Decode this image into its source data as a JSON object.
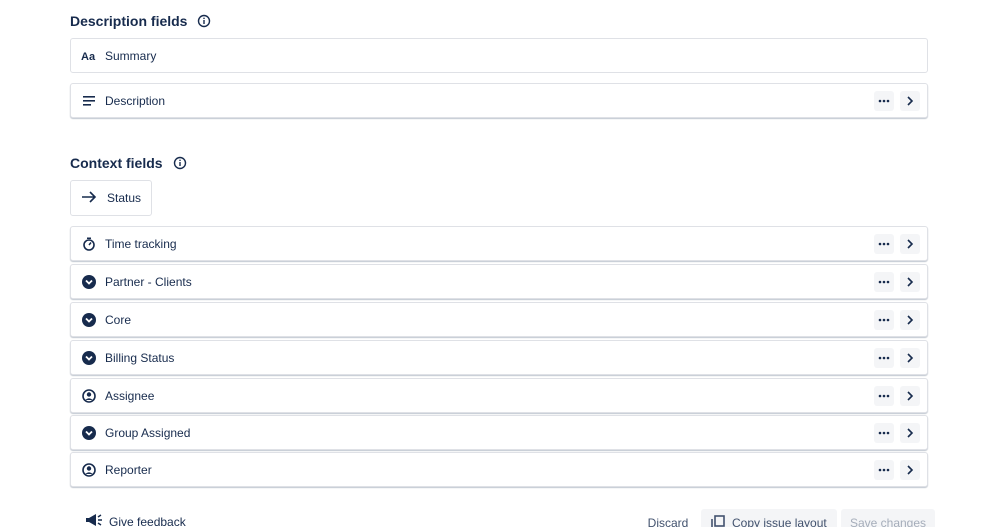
{
  "description_section": {
    "title": "Description fields",
    "fields": [
      {
        "label": "Summary",
        "icon": "text-type-icon",
        "has_actions": false
      },
      {
        "label": "Description",
        "icon": "paragraph-icon",
        "has_actions": true
      }
    ]
  },
  "context_section": {
    "title": "Context fields",
    "status_label": "Status",
    "fields": [
      {
        "label": "Time tracking",
        "icon": "stopwatch-icon"
      },
      {
        "label": "Partner - Clients",
        "icon": "dropdown-circle-icon"
      },
      {
        "label": "Core",
        "icon": "dropdown-circle-icon"
      },
      {
        "label": "Billing Status",
        "icon": "dropdown-circle-icon"
      },
      {
        "label": "Assignee",
        "icon": "user-circle-icon"
      },
      {
        "label": "Group Assigned",
        "icon": "dropdown-circle-icon"
      },
      {
        "label": "Reporter",
        "icon": "user-circle-icon"
      }
    ]
  },
  "footer": {
    "feedback_label": "Give feedback",
    "discard_label": "Discard",
    "copy_label": "Copy issue layout",
    "save_label": "Save changes"
  },
  "colors": {
    "text": "#172b4d",
    "border": "#dfe1e6",
    "button_bg": "#f4f5f7",
    "disabled_text": "#a5adba"
  }
}
